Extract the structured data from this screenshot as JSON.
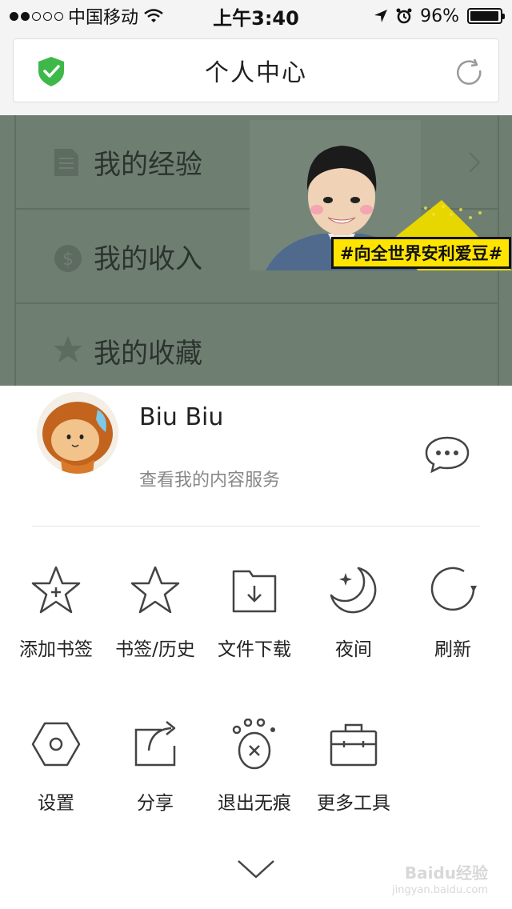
{
  "status_bar": {
    "carrier": "中国移动",
    "time": "上午3:40",
    "battery": "96%",
    "battery_level": 0.96
  },
  "address_bar": {
    "title": "个人中心"
  },
  "background_page": {
    "items": [
      {
        "label": "我的经验",
        "icon": "document-icon"
      },
      {
        "label": "我的收入",
        "icon": "dollar-icon"
      },
      {
        "label": "我的收藏",
        "icon": "star-icon"
      }
    ],
    "ad_tag": "#向全世界安利爱豆#"
  },
  "user": {
    "name": "Biu Biu",
    "subtitle": "查看我的内容服务"
  },
  "tools_row1": [
    {
      "label": "添加书签",
      "icon": "add-bookmark-icon"
    },
    {
      "label": "书签/历史",
      "icon": "bookmark-history-icon"
    },
    {
      "label": "文件下载",
      "icon": "download-folder-icon"
    },
    {
      "label": "夜间",
      "icon": "night-mode-icon"
    },
    {
      "label": "刷新",
      "icon": "refresh-icon"
    }
  ],
  "tools_row2": [
    {
      "label": "设置",
      "icon": "settings-icon"
    },
    {
      "label": "分享",
      "icon": "share-icon"
    },
    {
      "label": "退出无痕",
      "icon": "exit-incognito-icon"
    },
    {
      "label": "更多工具",
      "icon": "toolbox-icon"
    }
  ],
  "watermark": {
    "brand": "Baidu经验",
    "url": "jingyan.baidu.com"
  },
  "colors": {
    "shield_green": "#3fb84a",
    "overlay": "#6e7f72",
    "ad_yellow": "#ffe400"
  }
}
